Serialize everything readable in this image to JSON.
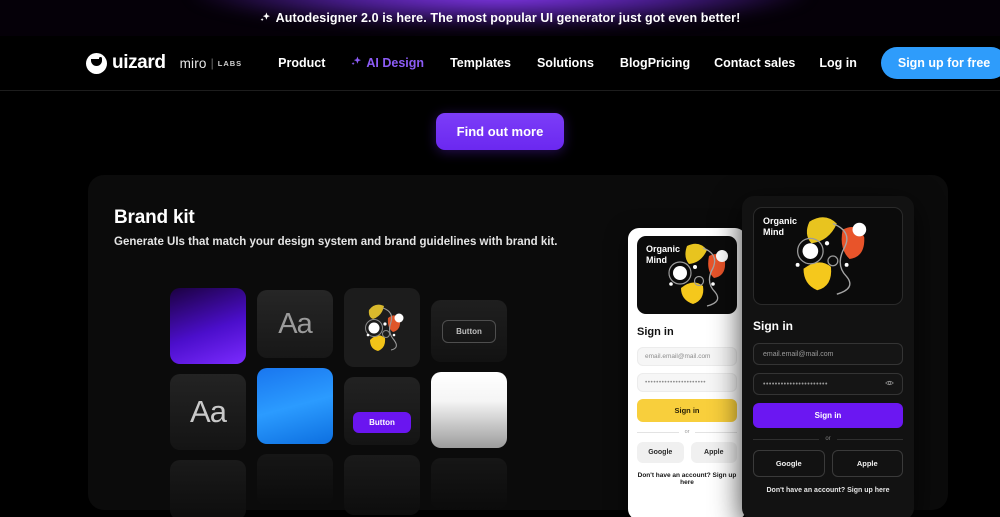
{
  "banner": {
    "icon": "sparkle-icon",
    "text": "Autodesigner 2.0 is here. The most popular UI generator just got even better!"
  },
  "nav": {
    "logo_word": "uizard",
    "logo_icon": "uizard-smile-logo",
    "partner": {
      "name": "miro",
      "divider": "|",
      "sub": "LABS"
    },
    "links": [
      {
        "label": "Product",
        "accent": false
      },
      {
        "label": "AI Design",
        "accent": true,
        "icon": "sparkle-icon"
      },
      {
        "label": "Templates",
        "accent": false
      },
      {
        "label": "Solutions",
        "accent": false
      },
      {
        "label": "Blog",
        "accent": false
      }
    ],
    "right_links": [
      {
        "label": "Pricing"
      },
      {
        "label": "Contact sales"
      },
      {
        "label": "Log in"
      }
    ],
    "signup_label": "Sign up for free",
    "signup_color": "#2e9cfb",
    "accent_color": "#8c5cf6"
  },
  "cta": {
    "label": "Find out more",
    "color": "#6b28f0"
  },
  "panel": {
    "title": "Brand kit",
    "subtitle": "Generate UIs that match your design system and brand guidelines with brand kit.",
    "swatches": {
      "col1": [
        {
          "name": "purple-gradient-swatch",
          "type": "gradient",
          "color": "#4b0ecb"
        },
        {
          "name": "typography-swatch",
          "type": "type",
          "label": "Aa"
        },
        {
          "name": "blank-dark-swatch",
          "type": "blank"
        }
      ],
      "col2": [
        {
          "name": "typography-swatch",
          "type": "type",
          "label": "Aa"
        },
        {
          "name": "blue-gradient-swatch",
          "type": "gradient",
          "color": "#2b9bff"
        },
        {
          "name": "blank-dark-swatch",
          "type": "blank"
        }
      ],
      "col3": [
        {
          "name": "illustration-swatch",
          "type": "illustration"
        },
        {
          "name": "filled-button-swatch",
          "type": "button-filled",
          "label": "Button",
          "color": "#6a15f0"
        },
        {
          "name": "blank-dark-swatch",
          "type": "blank"
        }
      ],
      "col4": [
        {
          "name": "outline-button-swatch",
          "type": "button-outline",
          "label": "Button"
        },
        {
          "name": "white-gradient-swatch",
          "type": "gradient",
          "color": "#ffffff"
        },
        {
          "name": "blank-dark-swatch",
          "type": "blank"
        }
      ]
    }
  },
  "mock_light": {
    "brand_line1": "Organic",
    "brand_line2": "Mind",
    "heading": "Sign in",
    "email_value": "email.email@mail.com",
    "password_value": "••••••••••••••••••••••",
    "primary_label": "Sign in",
    "or_label": "or",
    "social": [
      "Google",
      "Apple"
    ],
    "footer": "Don't have an account? Sign up here",
    "primary_color": "#f8cf3c"
  },
  "mock_dark": {
    "brand_line1": "Organic",
    "brand_line2": "Mind",
    "heading": "Sign in",
    "email_value": "email.email@mail.com",
    "password_value": "••••••••••••••••••••••",
    "primary_label": "Sign in",
    "or_label": "or",
    "social": [
      "Google",
      "Apple"
    ],
    "footer": "Don't have an account? Sign up here",
    "primary_color": "#6b17f2",
    "eye_icon": "eye-icon"
  }
}
